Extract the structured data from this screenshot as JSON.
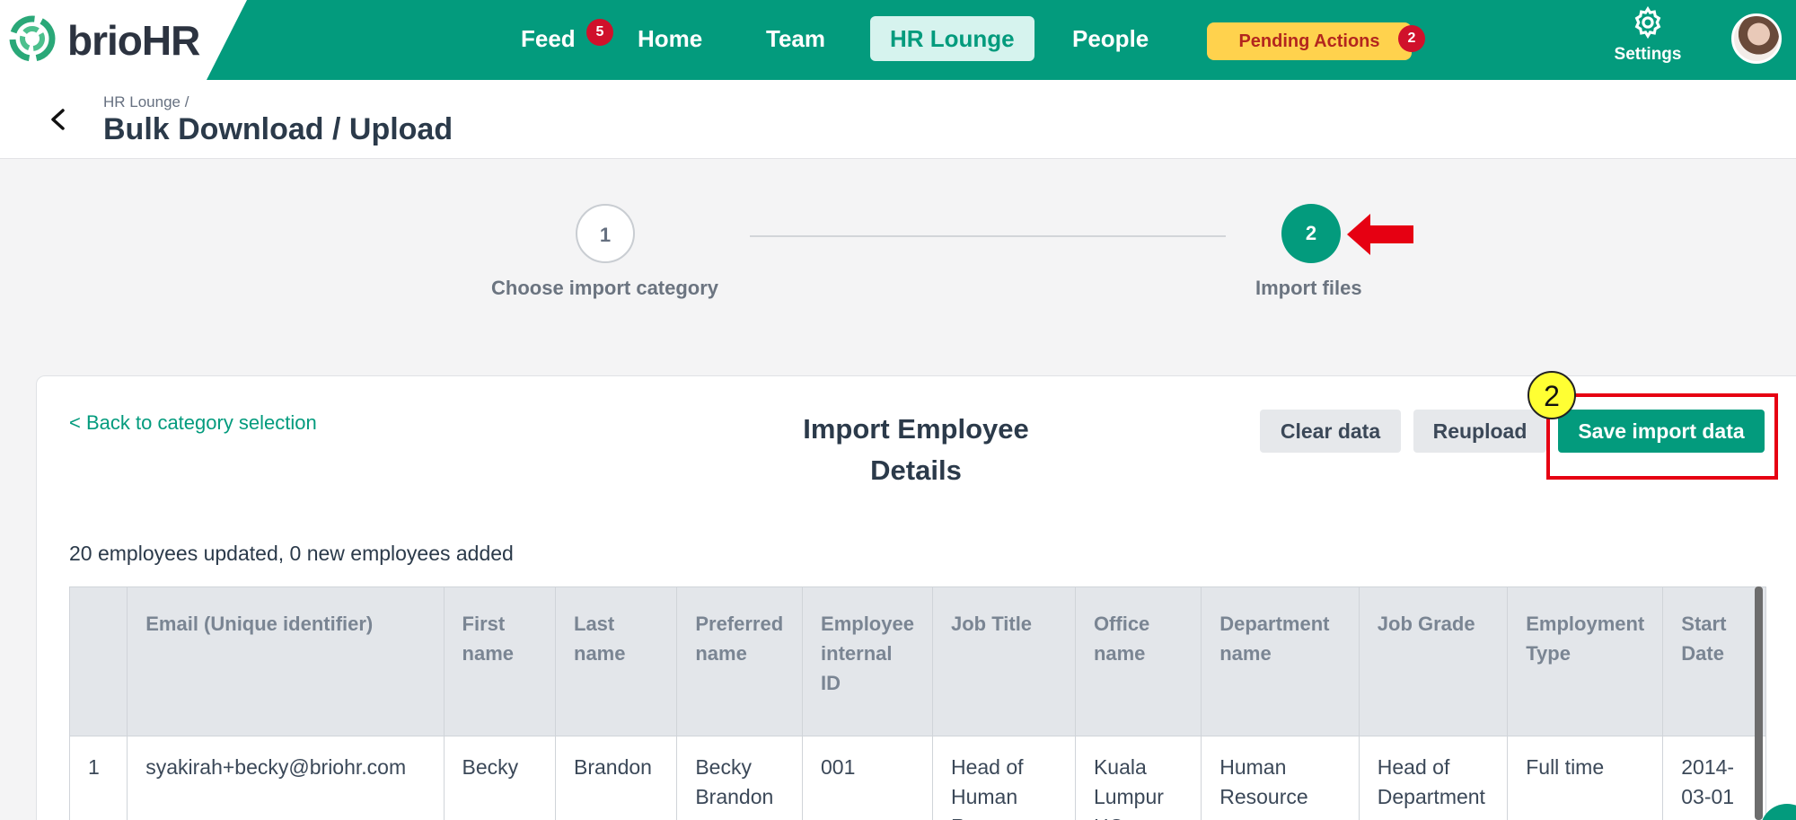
{
  "brand": {
    "name_part1": "brio",
    "name_part2": "HR",
    "accent": "#039b7d"
  },
  "nav": {
    "items": [
      {
        "label": "Feed",
        "badge": "5"
      },
      {
        "label": "Home"
      },
      {
        "label": "Team"
      },
      {
        "label": "HR Lounge",
        "active": true
      },
      {
        "label": "People"
      }
    ],
    "pending": {
      "label": "Pending Actions",
      "badge": "2"
    },
    "settings_label": "Settings"
  },
  "header": {
    "breadcrumb": "HR Lounge /",
    "title": "Bulk Download / Upload"
  },
  "stepper": {
    "steps": [
      {
        "number": "1",
        "label": "Choose import category"
      },
      {
        "number": "2",
        "label": "Import files"
      }
    ]
  },
  "card": {
    "back_link": "< Back to category selection",
    "title_line1": "Import Employee",
    "title_line2": "Details",
    "buttons": {
      "clear": "Clear data",
      "reupload": "Reupload",
      "save": "Save import data"
    },
    "annotation_number": "2",
    "summary": "20 employees updated, 0 new employees added"
  },
  "table": {
    "headers": [
      "",
      "Email (Unique identifier)",
      "First name",
      "Last name",
      "Preferred name",
      "Employee internal ID",
      "Job Title",
      "Office name",
      "Department name",
      "Job Grade",
      "Employment Type",
      "Start Date"
    ],
    "rows": [
      [
        "1",
        "syakirah+becky@briohr.com",
        "Becky",
        "Brandon",
        "Becky Brandon",
        "001",
        "Head of Human Resource",
        "Kuala Lumpur HQ",
        "Human Resource",
        "Head of Department",
        "Full time",
        "2014-03-01"
      ]
    ]
  }
}
